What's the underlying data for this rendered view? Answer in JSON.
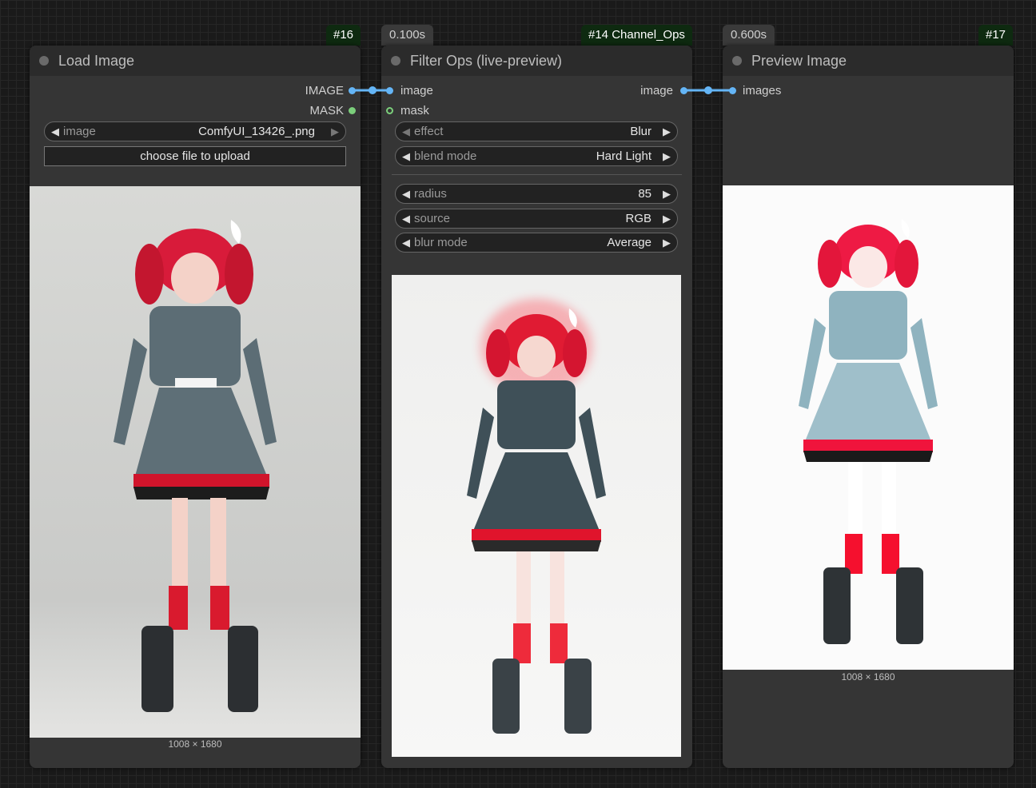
{
  "node_load": {
    "id": "#16",
    "title": "Load Image",
    "outputs": [
      "IMAGE",
      "MASK"
    ],
    "image_widget": {
      "label": "image",
      "value": "ComfyUI_13426_.png"
    },
    "upload_label": "choose file to upload",
    "dims": "1008 × 1680"
  },
  "node_filter": {
    "id": "#14 Channel_Ops",
    "time": "0.100s",
    "title": "Filter Ops (live-preview)",
    "inputs": [
      "image",
      "mask"
    ],
    "output": "image",
    "widgets": [
      {
        "label": "effect",
        "value": "Blur"
      },
      {
        "label": "blend mode",
        "value": "Hard Light"
      },
      {
        "label": "radius",
        "value": "85"
      },
      {
        "label": "source",
        "value": "RGB"
      },
      {
        "label": "blur mode",
        "value": "Average"
      }
    ]
  },
  "node_preview": {
    "id": "#17",
    "time": "0.600s",
    "title": "Preview Image",
    "input": "images",
    "dims": "1008 × 1680"
  },
  "colors": {
    "image_wire": "#64b5f6",
    "mask_slot": "#7bcf7b",
    "id_badge": "#0e2a10"
  }
}
